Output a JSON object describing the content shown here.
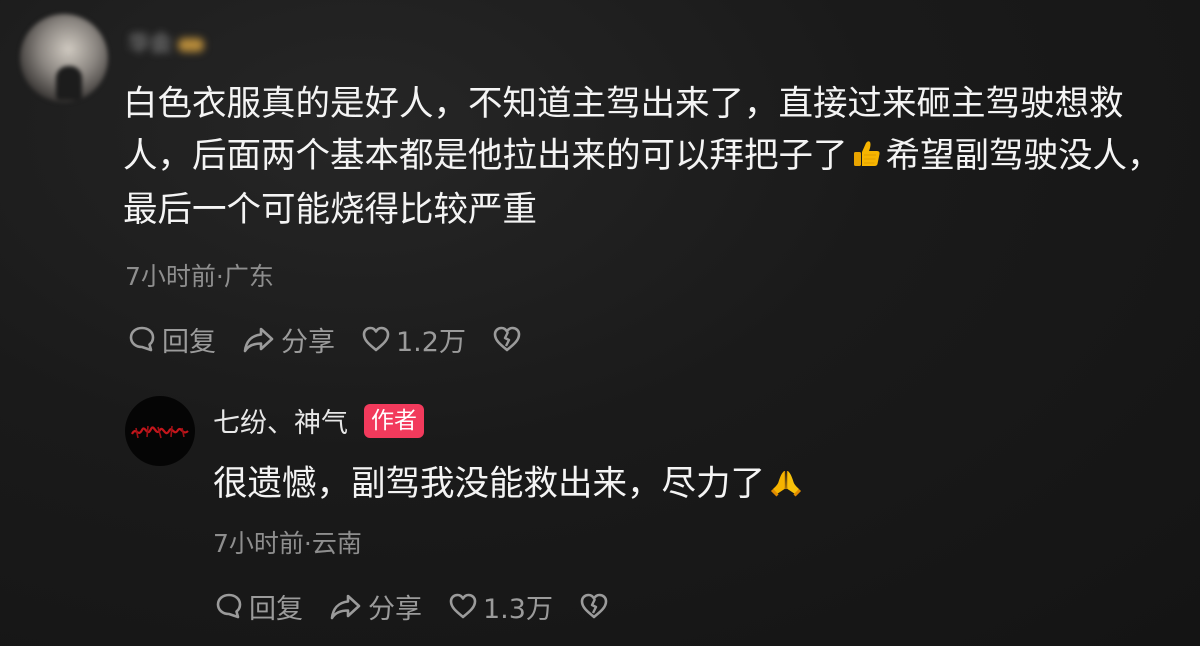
{
  "comment": {
    "username_blurred": "华会",
    "text_part1": "白色衣服真的是好人，不知道主驾出来了，直接过来砸主驾驶想救人，后面两个基本都是他拉出来的可以拜把子了",
    "emoji": "thumbs-up-emoji",
    "text_part2": "希望副驾驶没人，最后一个可能烧得比较严重",
    "meta": "7小时前·广东",
    "reply_label": "回复",
    "share_label": "分享",
    "like_count": "1.2万"
  },
  "reply": {
    "username": "七纷、神气",
    "author_badge": "作者",
    "text": "很遗憾，副驾我没能救出来，尽力了",
    "emoji": "folded-hands-emoji",
    "meta": "7小时前·云南",
    "reply_label": "回复",
    "share_label": "分享",
    "like_count": "1.3万"
  },
  "colors": {
    "background": "#161616",
    "author_badge": "#f23a5c",
    "text_primary": "#f4f4f4",
    "text_secondary": "#8e8e8e",
    "emoji_yellow": "#f5b400"
  }
}
